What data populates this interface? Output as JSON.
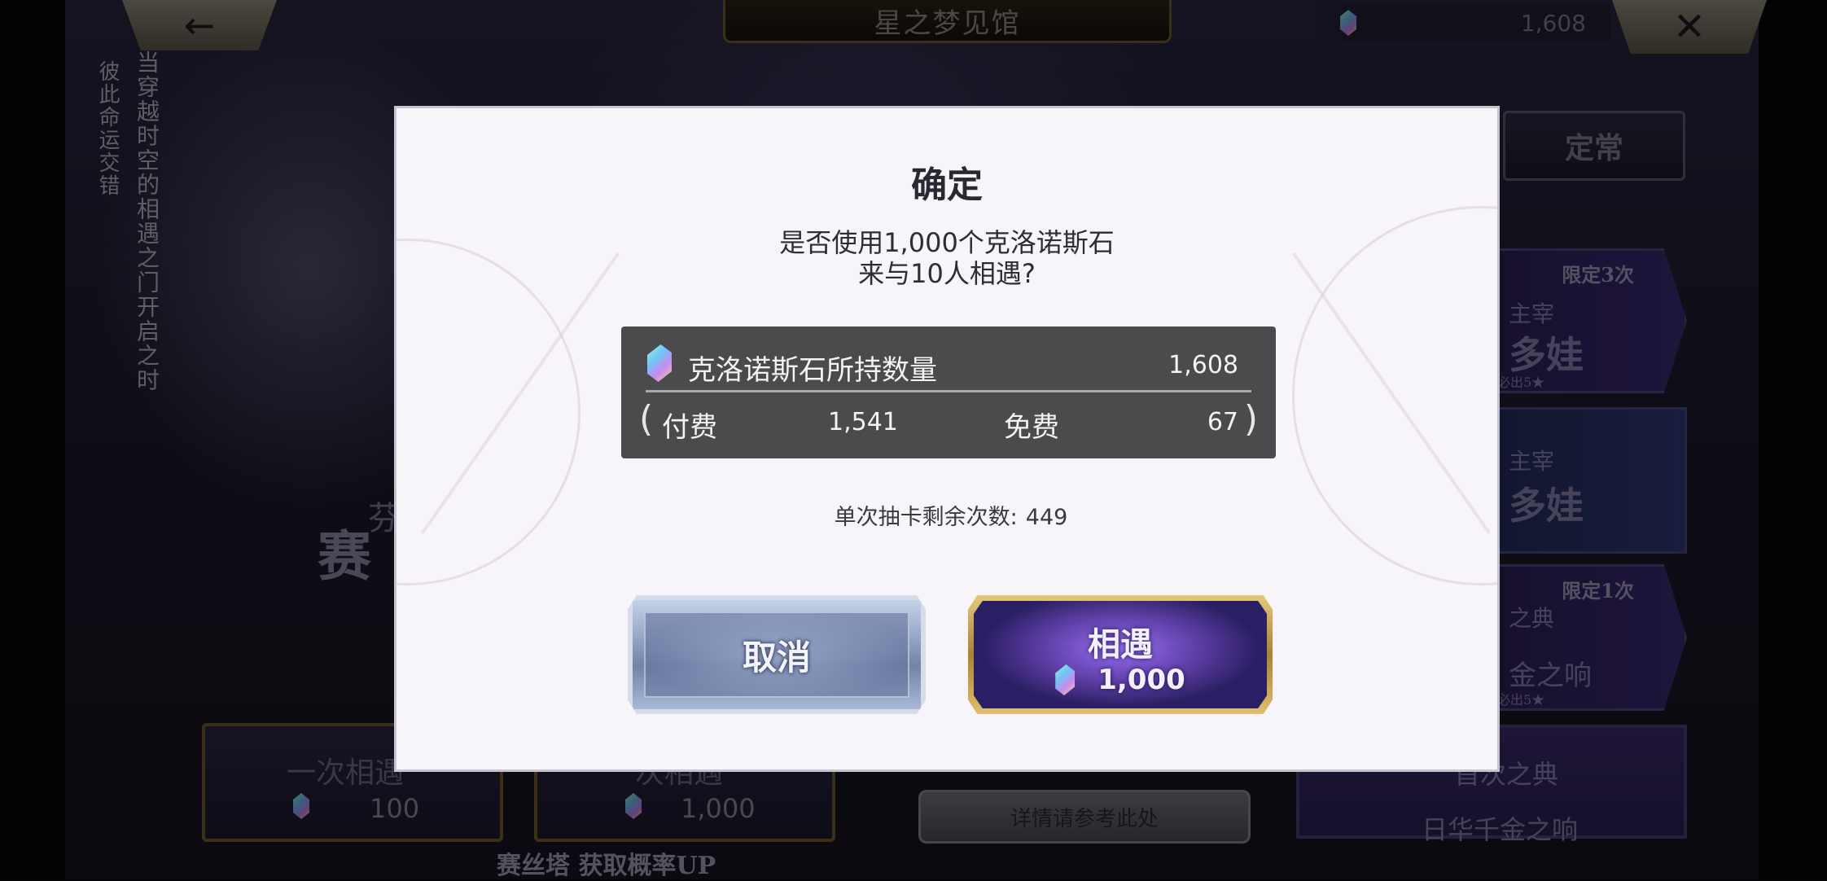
{
  "header": {
    "title": "星之梦见馆",
    "back_icon": "←",
    "close_icon": "✕",
    "crystal_balance": "1,608"
  },
  "background": {
    "vertical_text_1": "当穿越时空的相遇之门开启之时",
    "vertical_text_2": "彼此命运交错",
    "banner_title": "赛",
    "banner_sub": "芬",
    "draw_single": {
      "label": "一次相遇",
      "cost": "100"
    },
    "draw_ten": {
      "label": "次相遇",
      "cost": "1,000"
    },
    "footer_text": "赛丝塔 获取概率UP",
    "details_button": "详情请参考此处",
    "tab_regular": "定常",
    "side_cards": [
      {
        "limit": "限定3次",
        "line1": "主宰",
        "line2": "多娃",
        "note": "必出5★"
      },
      {
        "limit": "",
        "line1": "主宰",
        "line2": "多娃",
        "note": ""
      },
      {
        "limit": "限定1次",
        "line1": "之典",
        "line2": "金之响",
        "note": "必出5★"
      },
      {
        "limit": "",
        "line1": "首次之典",
        "line2": "日华千金之响",
        "note": ""
      }
    ]
  },
  "dialog": {
    "title": "确定",
    "message_line1": "是否使用1,000个克洛诺斯石",
    "message_line2": "来与10人相遇?",
    "holdings_label": "克洛诺斯石所持数量",
    "holdings_value": "1,608",
    "paren_open": "(",
    "paren_close": ")",
    "paid_label": "付费",
    "paid_value": "1,541",
    "free_label": "免费",
    "free_value": "67",
    "remaining_label": "单次抽卡剩余次数:",
    "remaining_value": "449",
    "cancel_button": "取消",
    "confirm_button": "相遇",
    "confirm_cost": "1,000"
  },
  "icons": [
    "back-arrow-icon",
    "close-icon",
    "crystal-icon"
  ],
  "colors": {
    "dialog_bg": "#f7f4fa",
    "panel_bg": "#4b4b4e",
    "confirm_purple": "#5a3fc0",
    "confirm_gold": "#c9a550",
    "cancel_silver": "#8798bb"
  }
}
